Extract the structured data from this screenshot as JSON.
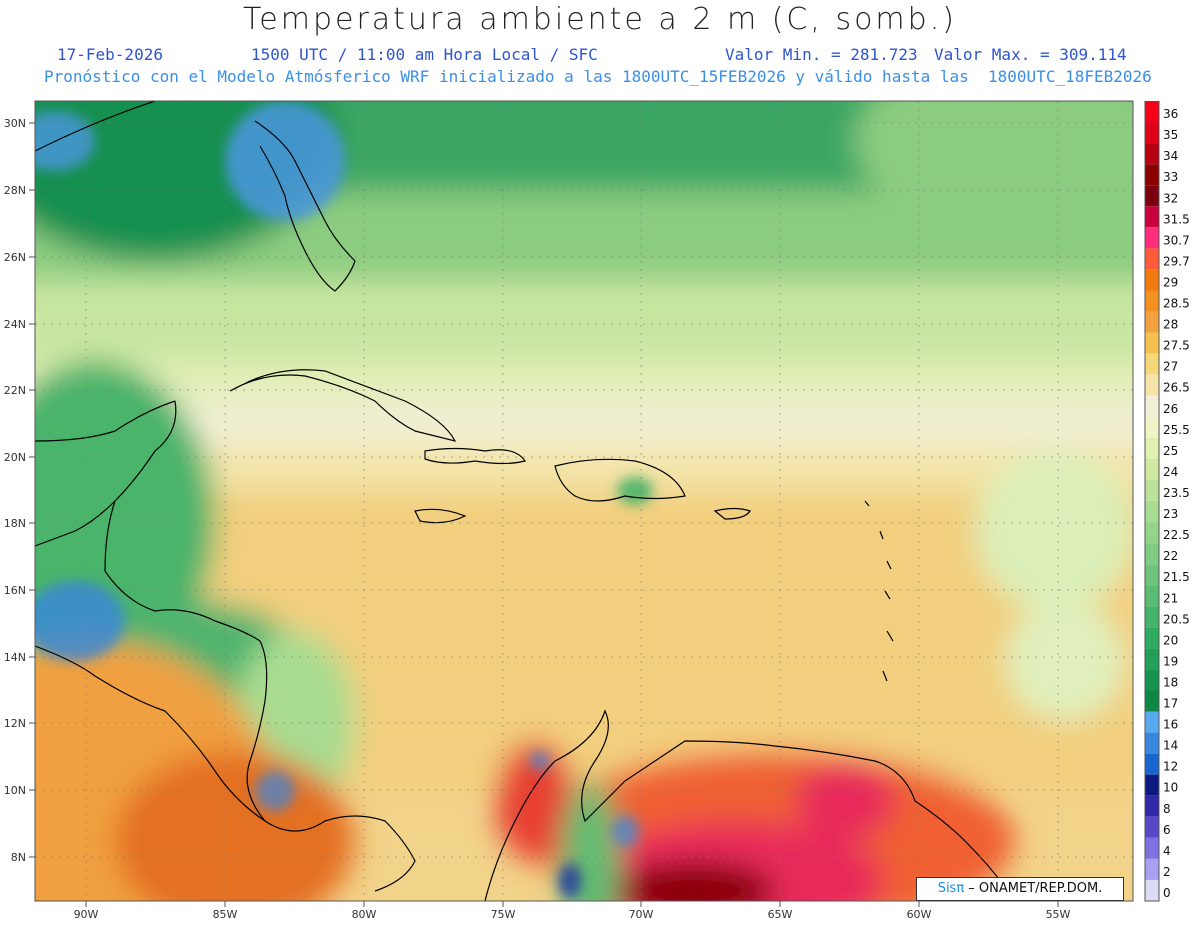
{
  "header": {
    "title": "Temperatura ambiente a 2 m (C, somb.)",
    "date": "17-Feb-2026",
    "time": "1500 UTC / 11:00 am Hora Local / SFC",
    "valmin": "Valor Min. = 281.723",
    "valmax": "Valor Max. = 309.114",
    "forecast": "Pronóstico con el Modelo Atmósferico WRF inicializado a las 1800UTC_15FEB2026 y válido hasta las  1800UTC_18FEB2026"
  },
  "axes": {
    "lat_labels": [
      "30N",
      "28N",
      "26N",
      "24N",
      "22N",
      "20N",
      "18N",
      "16N",
      "14N",
      "12N",
      "10N",
      "8N"
    ],
    "lon_labels": [
      "90W",
      "85W",
      "80W",
      "75W",
      "70W",
      "65W",
      "60W",
      "55W"
    ]
  },
  "legend": {
    "labels": [
      "36",
      "35",
      "34",
      "33",
      "32",
      "31.5",
      "30.7",
      "29.7",
      "29",
      "28.5",
      "28",
      "27.5",
      "27",
      "26.5",
      "26",
      "25.5",
      "25",
      "24",
      "23.5",
      "23",
      "22.5",
      "22",
      "21.5",
      "21",
      "20.5",
      "20",
      "19",
      "18",
      "17",
      "16",
      "14",
      "12",
      "10",
      "8",
      "6",
      "4",
      "2",
      "0"
    ],
    "colors": [
      "#f4001a",
      "#e0001a",
      "#b80015",
      "#8c0000",
      "#7a0010",
      "#c8003c",
      "#ff2d7e",
      "#ff5a3a",
      "#f07a10",
      "#f29020",
      "#f2a040",
      "#f5c050",
      "#f5d878",
      "#f5e3a8",
      "#f3f0d8",
      "#eff5c8",
      "#e0f0b0",
      "#cfeaa0",
      "#bde39a",
      "#a8dc92",
      "#94d48a",
      "#80cc82",
      "#6cc47a",
      "#58bc72",
      "#44b46a",
      "#30ac62",
      "#20a058",
      "#14944e",
      "#0c8844",
      "#5aaaf0",
      "#3a88e0",
      "#1866d0",
      "#0c1a80",
      "#3028a8",
      "#5a48c8",
      "#8070e0",
      "#a8a0f0",
      "#dcdcf4"
    ]
  },
  "credit": {
    "brand": "Sis",
    "pi": "π",
    "rest": " – ONAMET/REP.DOM."
  }
}
